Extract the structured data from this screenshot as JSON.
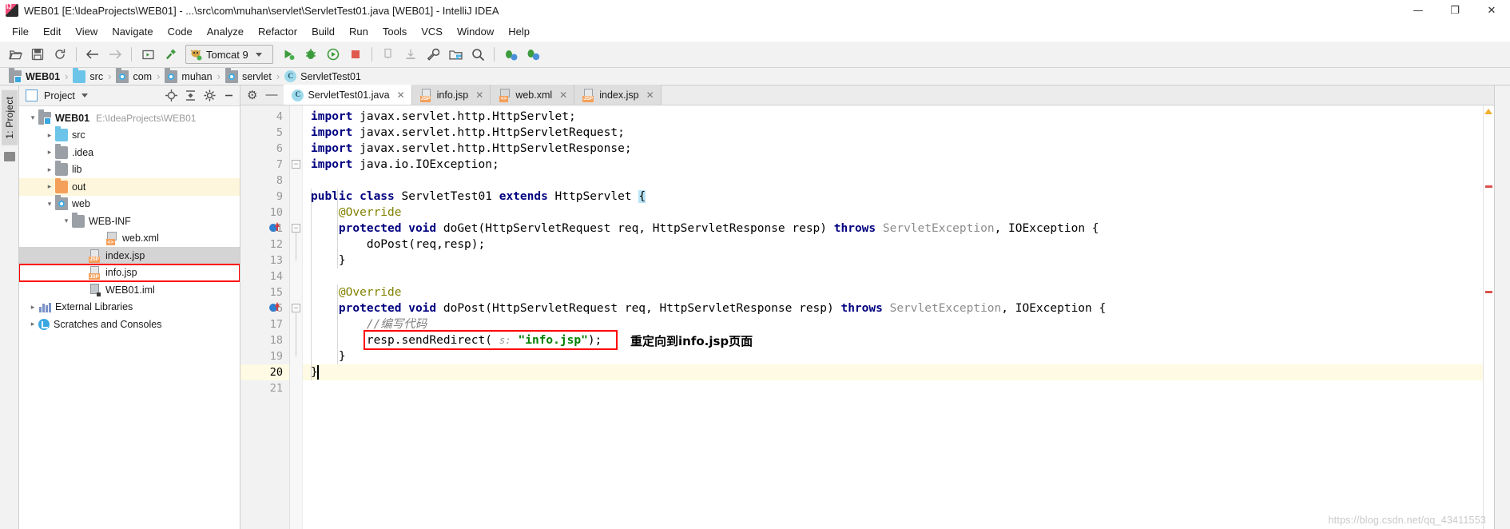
{
  "window": {
    "title": "WEB01 [E:\\IdeaProjects\\WEB01] - ...\\src\\com\\muhan\\servlet\\ServletTest01.java [WEB01] - IntelliJ IDEA",
    "logo_text": "IJ",
    "minimize": "—",
    "maximize": "❐",
    "close": "✕"
  },
  "menu": {
    "items": [
      {
        "label": "File"
      },
      {
        "label": "Edit"
      },
      {
        "label": "View"
      },
      {
        "label": "Navigate"
      },
      {
        "label": "Code"
      },
      {
        "label": "Analyze"
      },
      {
        "label": "Refactor"
      },
      {
        "label": "Build"
      },
      {
        "label": "Run"
      },
      {
        "label": "Tools"
      },
      {
        "label": "VCS"
      },
      {
        "label": "Window"
      },
      {
        "label": "Help"
      }
    ]
  },
  "toolbar": {
    "run_config_label": "Tomcat 9",
    "buttons": [
      {
        "name": "open-project-icon"
      },
      {
        "name": "save-all-icon"
      },
      {
        "name": "sync-icon"
      },
      {
        "name": "back-icon"
      },
      {
        "name": "forward-icon"
      },
      {
        "name": "compile-icon"
      },
      {
        "name": "build-hammer-icon"
      },
      {
        "name": "run-icon"
      },
      {
        "name": "debug-icon"
      },
      {
        "name": "run-coverage-icon"
      },
      {
        "name": "stop-icon"
      },
      {
        "name": "update-project-icon"
      },
      {
        "name": "commit-icon"
      },
      {
        "name": "settings-wrench-icon"
      },
      {
        "name": "project-structure-icon"
      },
      {
        "name": "search-everywhere-icon"
      },
      {
        "name": "attach-debugger-icon"
      },
      {
        "name": "profiler-icon"
      }
    ]
  },
  "breadcrumb": {
    "items": [
      {
        "label": "WEB01",
        "icon": "module-icon",
        "bold": true
      },
      {
        "label": "src",
        "icon": "source-folder-icon",
        "bold": false
      },
      {
        "label": "com",
        "icon": "package-icon",
        "bold": false
      },
      {
        "label": "muhan",
        "icon": "package-icon",
        "bold": false
      },
      {
        "label": "servlet",
        "icon": "package-icon",
        "bold": false
      },
      {
        "label": "ServletTest01",
        "icon": "class-icon",
        "bold": false
      }
    ],
    "separator": "›"
  },
  "left_strip": {
    "project_tab": "1: Project"
  },
  "project_panel": {
    "title": "Project",
    "header_icons": [
      {
        "name": "locate-target-icon"
      },
      {
        "name": "collapse-all-icon"
      },
      {
        "name": "settings-gear-icon"
      },
      {
        "name": "hide-panel-icon"
      }
    ],
    "tree": [
      {
        "indent": 0,
        "twisty": "⌄",
        "icon": "module-icon",
        "label": "WEB01",
        "sublabel": "E:\\IdeaProjects\\WEB01",
        "bold": true,
        "state": "none"
      },
      {
        "indent": 1,
        "twisty": "›",
        "icon": "source-folder-icon",
        "label": "src",
        "sublabel": "",
        "bold": false,
        "state": "none"
      },
      {
        "indent": 1,
        "twisty": "›",
        "icon": "folder-icon",
        "label": ".idea",
        "sublabel": "",
        "bold": false,
        "state": "none"
      },
      {
        "indent": 1,
        "twisty": "›",
        "icon": "folder-icon",
        "label": "lib",
        "sublabel": "",
        "bold": false,
        "state": "none"
      },
      {
        "indent": 1,
        "twisty": "›",
        "icon": "output-folder-icon",
        "label": "out",
        "sublabel": "",
        "bold": false,
        "state": "highlight"
      },
      {
        "indent": 1,
        "twisty": "⌄",
        "icon": "web-folder-icon",
        "label": "web",
        "sublabel": "",
        "bold": false,
        "state": "none"
      },
      {
        "indent": 2,
        "twisty": "⌄",
        "icon": "folder-icon",
        "label": "WEB-INF",
        "sublabel": "",
        "bold": false,
        "state": "none"
      },
      {
        "indent": 4,
        "twisty": "",
        "icon": "xml-file-icon",
        "label": "web.xml",
        "sublabel": "",
        "bold": false,
        "state": "none"
      },
      {
        "indent": 3,
        "twisty": "",
        "icon": "jsp-file-icon",
        "label": "index.jsp",
        "sublabel": "",
        "bold": false,
        "state": "selected"
      },
      {
        "indent": 3,
        "twisty": "",
        "icon": "jsp-file-icon",
        "label": "info.jsp",
        "sublabel": "",
        "bold": false,
        "state": "boxed"
      },
      {
        "indent": 3,
        "twisty": "",
        "icon": "iml-file-icon",
        "label": "WEB01.iml",
        "sublabel": "",
        "bold": false,
        "state": "none"
      },
      {
        "indent": 0,
        "twisty": "›",
        "icon": "library-icon",
        "label": "External Libraries",
        "sublabel": "",
        "bold": false,
        "state": "none"
      },
      {
        "indent": 0,
        "twisty": "›",
        "icon": "scratches-icon",
        "label": "Scratches and Consoles",
        "sublabel": "",
        "bold": false,
        "state": "none"
      }
    ]
  },
  "editor": {
    "tabs": [
      {
        "label": "ServletTest01.java",
        "icon": "class-icon",
        "active": true,
        "close": "✕"
      },
      {
        "label": "info.jsp",
        "icon": "jsp-file-icon",
        "active": false,
        "close": "✕"
      },
      {
        "label": "web.xml",
        "icon": "xml-file-icon",
        "active": false,
        "close": "✕"
      },
      {
        "label": "index.jsp",
        "icon": "jsp-file-icon",
        "active": false,
        "close": "✕"
      }
    ],
    "tab_tools": [
      {
        "name": "settings-gear-icon",
        "glyph": "⚙"
      },
      {
        "name": "hide-editor-icon",
        "glyph": "—"
      }
    ],
    "current_line": 20,
    "first_line": 4,
    "lines": [
      {
        "n": 4,
        "tokens": [
          {
            "t": "import",
            "c": "kw"
          },
          {
            "t": " javax.servlet.http.HttpServlet;",
            "c": "plain"
          }
        ]
      },
      {
        "n": 5,
        "tokens": [
          {
            "t": "import",
            "c": "kw"
          },
          {
            "t": " javax.servlet.http.HttpServletRequest;",
            "c": "plain"
          }
        ]
      },
      {
        "n": 6,
        "tokens": [
          {
            "t": "import",
            "c": "kw"
          },
          {
            "t": " javax.servlet.http.HttpServletResponse;",
            "c": "plain"
          }
        ]
      },
      {
        "n": 7,
        "tokens": [
          {
            "t": "import",
            "c": "kw"
          },
          {
            "t": " java.io.IOException;",
            "c": "plain"
          }
        ]
      },
      {
        "n": 8,
        "tokens": []
      },
      {
        "n": 9,
        "tokens": [
          {
            "t": "public class",
            "c": "kw"
          },
          {
            "t": " ServletTest01 ",
            "c": "plain"
          },
          {
            "t": "extends",
            "c": "kw"
          },
          {
            "t": " HttpServlet ",
            "c": "plain"
          },
          {
            "t": "{",
            "c": "brace-hl"
          }
        ]
      },
      {
        "n": 10,
        "tokens": [
          {
            "t": "    @Override",
            "c": "ann"
          }
        ]
      },
      {
        "n": 11,
        "tokens": [
          {
            "t": "    protected void",
            "c": "kw"
          },
          {
            "t": " doGet(HttpServletRequest req, HttpServletResponse resp) ",
            "c": "plain"
          },
          {
            "t": "throws",
            "c": "kw"
          },
          {
            "t": " ",
            "c": "plain"
          },
          {
            "t": "ServletException",
            "c": "grey"
          },
          {
            "t": ", IOException {",
            "c": "plain"
          }
        ]
      },
      {
        "n": 12,
        "tokens": [
          {
            "t": "        doPost(req,resp);",
            "c": "plain"
          }
        ]
      },
      {
        "n": 13,
        "tokens": [
          {
            "t": "    }",
            "c": "plain"
          }
        ]
      },
      {
        "n": 14,
        "tokens": []
      },
      {
        "n": 15,
        "tokens": [
          {
            "t": "    @Override",
            "c": "ann"
          }
        ]
      },
      {
        "n": 16,
        "tokens": [
          {
            "t": "    protected void",
            "c": "kw"
          },
          {
            "t": " doPost(HttpServletRequest req, HttpServletResponse resp) ",
            "c": "plain"
          },
          {
            "t": "throws",
            "c": "kw"
          },
          {
            "t": " ",
            "c": "plain"
          },
          {
            "t": "ServletException",
            "c": "grey"
          },
          {
            "t": ", IOException {",
            "c": "plain"
          }
        ]
      },
      {
        "n": 17,
        "tokens": [
          {
            "t": "        //编写代码",
            "c": "cmt"
          }
        ]
      },
      {
        "n": 18,
        "tokens": [
          {
            "t": "        resp.sendRedirect( ",
            "c": "plain"
          },
          {
            "t": "s:",
            "c": "hintp"
          },
          {
            "t": " ",
            "c": "plain"
          },
          {
            "t": "\"info.jsp\"",
            "c": "str"
          },
          {
            "t": ");",
            "c": "plain"
          }
        ]
      },
      {
        "n": 19,
        "tokens": [
          {
            "t": "    }",
            "c": "plain"
          }
        ]
      },
      {
        "n": 20,
        "tokens": [
          {
            "t": "}",
            "c": "plain"
          }
        ]
      },
      {
        "n": 21,
        "tokens": []
      }
    ],
    "annotations": [
      {
        "name": "sendredirect-callout",
        "text": "重定向到info.jsp页面"
      }
    ]
  },
  "watermark": "https://blog.csdn.net/qq_43411553"
}
